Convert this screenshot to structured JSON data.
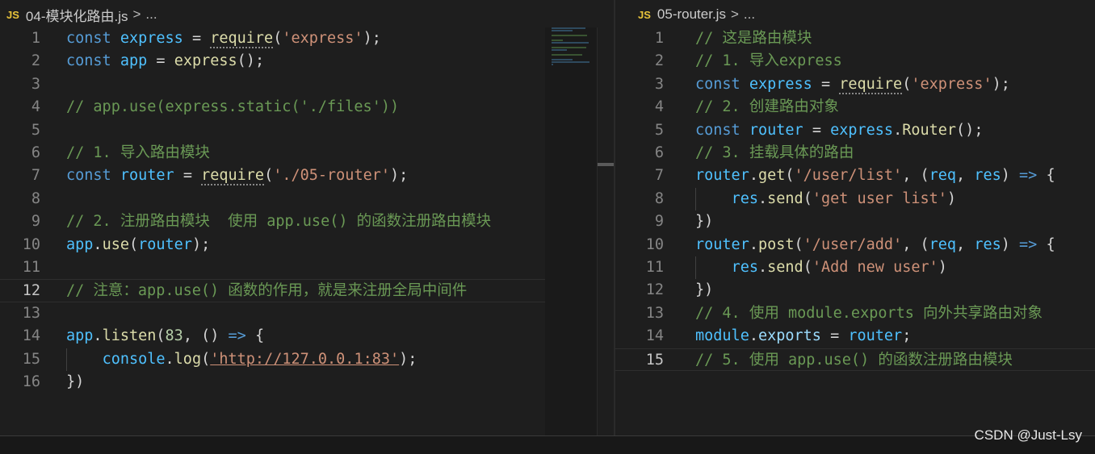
{
  "left_tab": {
    "icon": "JS",
    "filename": "04-模块化路由.js",
    "chevron": ">",
    "more": "..."
  },
  "right_tab": {
    "icon": "JS",
    "filename": "05-router.js",
    "chevron": ">",
    "more": "..."
  },
  "left_lines": [
    "const express = require('express');",
    "const app = express();",
    "",
    "// app.use(express.static('./files'))",
    "",
    "// 1. 导入路由模块",
    "const router = require('./05-router');",
    "",
    "// 2. 注册路由模块  使用 app.use() 的函数注册路由模块",
    "app.use(router);",
    "",
    "// 注意：app.use() 函数的作用，就是来注册全局中间件",
    "",
    "app.listen(83, () => {",
    "    console.log('http://127.0.0.1:83');",
    "})"
  ],
  "right_lines": [
    "// 这是路由模块",
    "// 1. 导入express",
    "const express = require('express');",
    "// 2. 创建路由对象",
    "const router = express.Router();",
    "// 3. 挂载具体的路由",
    "router.get('/user/list', (req, res) => {",
    "    res.send('get user list')",
    "})",
    "router.post('/user/add', (req, res) => {",
    "    res.send('Add new user')",
    "})",
    "// 4. 使用 module.exports 向外共享路由对象",
    "module.exports = router;",
    "// 5. 使用 app.use() 的函数注册路由模块"
  ],
  "left_active_line": 12,
  "right_active_line": 15,
  "watermark": "CSDN @Just-Lsy"
}
